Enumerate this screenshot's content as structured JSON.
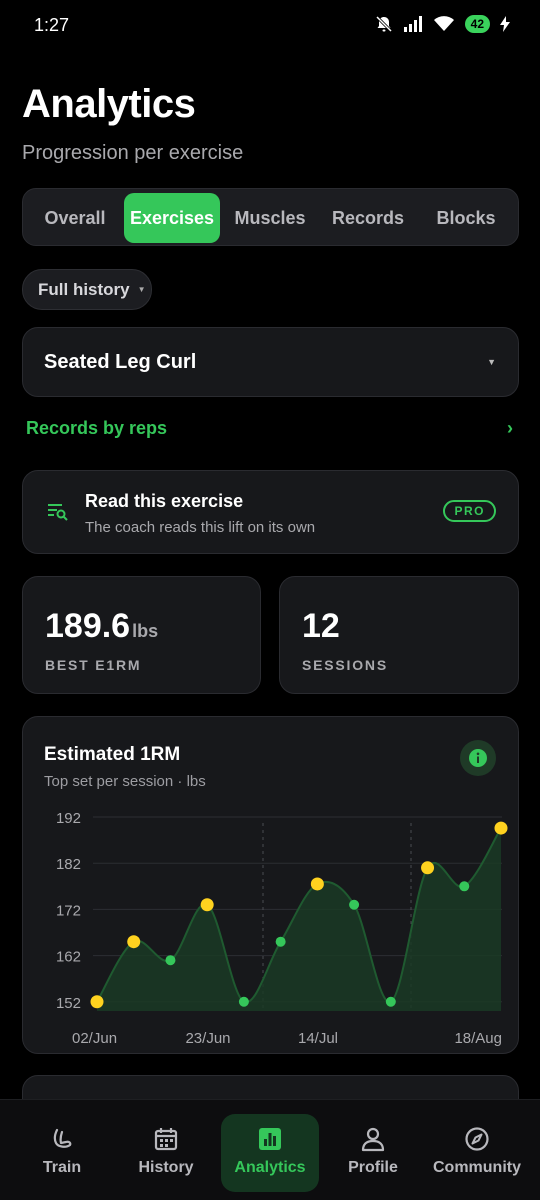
{
  "status": {
    "time": "1:27",
    "battery": "42"
  },
  "header": {
    "title": "Analytics",
    "subtitle": "Progression per exercise"
  },
  "tabs": [
    {
      "label": "Overall",
      "active": false
    },
    {
      "label": "Exercises",
      "active": true
    },
    {
      "label": "Muscles",
      "active": false
    },
    {
      "label": "Records",
      "active": false
    },
    {
      "label": "Blocks",
      "active": false
    }
  ],
  "filter": {
    "label": "Full history"
  },
  "exercise_selector": {
    "value": "Seated Leg Curl"
  },
  "records_link": {
    "label": "Records by reps",
    "chevron": "›"
  },
  "coach_card": {
    "title": "Read this exercise",
    "description": "The coach reads this lift on its own",
    "badge": "PRO",
    "icon": "search-list-icon"
  },
  "stats": {
    "best_e1rm": {
      "value": "189.6",
      "unit": "lbs",
      "label": "BEST E1RM"
    },
    "sessions": {
      "value": "12",
      "label": "SESSIONS"
    }
  },
  "chart_card": {
    "title": "Estimated 1RM",
    "subtitle": "Top set per session · lbs",
    "info_icon": "info-icon"
  },
  "colors": {
    "accent": "#35c75a",
    "pr_marker": "#ffd21f",
    "background": "#000000",
    "card": "#17181b"
  },
  "chart_data": {
    "type": "area",
    "title": "Estimated 1RM",
    "subtitle": "Top set per session · lbs",
    "ylim": [
      150,
      192
    ],
    "yticks": [
      "192",
      "182",
      "172",
      "162",
      "152"
    ],
    "xtick_labels": [
      "02/Jun",
      "23/Jun",
      "14/Jul",
      "18/Aug"
    ],
    "grid": true,
    "series": [
      {
        "values": [
          152,
          165,
          161,
          173,
          152,
          165,
          177.5,
          173,
          152,
          181,
          177,
          189.6
        ],
        "pr": [
          true,
          true,
          false,
          true,
          false,
          false,
          true,
          false,
          false,
          true,
          false,
          true
        ]
      }
    ]
  },
  "nav": [
    {
      "label": "Train",
      "icon": "train-icon",
      "active": false
    },
    {
      "label": "History",
      "icon": "calendar-icon",
      "active": false
    },
    {
      "label": "Analytics",
      "icon": "bar-chart-icon",
      "active": true
    },
    {
      "label": "Profile",
      "icon": "person-icon",
      "active": false
    },
    {
      "label": "Community",
      "icon": "compass-icon",
      "active": false
    }
  ]
}
